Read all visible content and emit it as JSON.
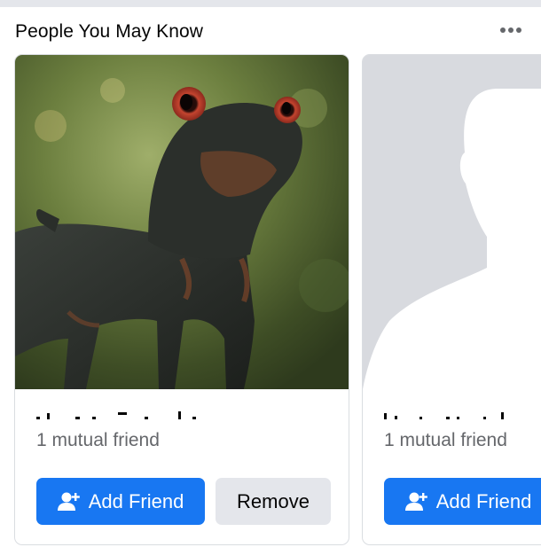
{
  "section": {
    "title": "People You May Know",
    "more_icon": "more-horizontal-icon"
  },
  "cards": [
    {
      "mutual": "1 mutual friend",
      "add_label": "Add Friend",
      "remove_label": "Remove",
      "add_icon": "person-add-icon"
    },
    {
      "mutual": "1 mutual friend",
      "add_label": "Add Friend",
      "add_icon": "person-add-icon"
    }
  ],
  "colors": {
    "primary": "#1877f2",
    "secondary_bg": "#e4e6eb",
    "muted_text": "#65676b",
    "placeholder_bg": "#d8dadf"
  }
}
